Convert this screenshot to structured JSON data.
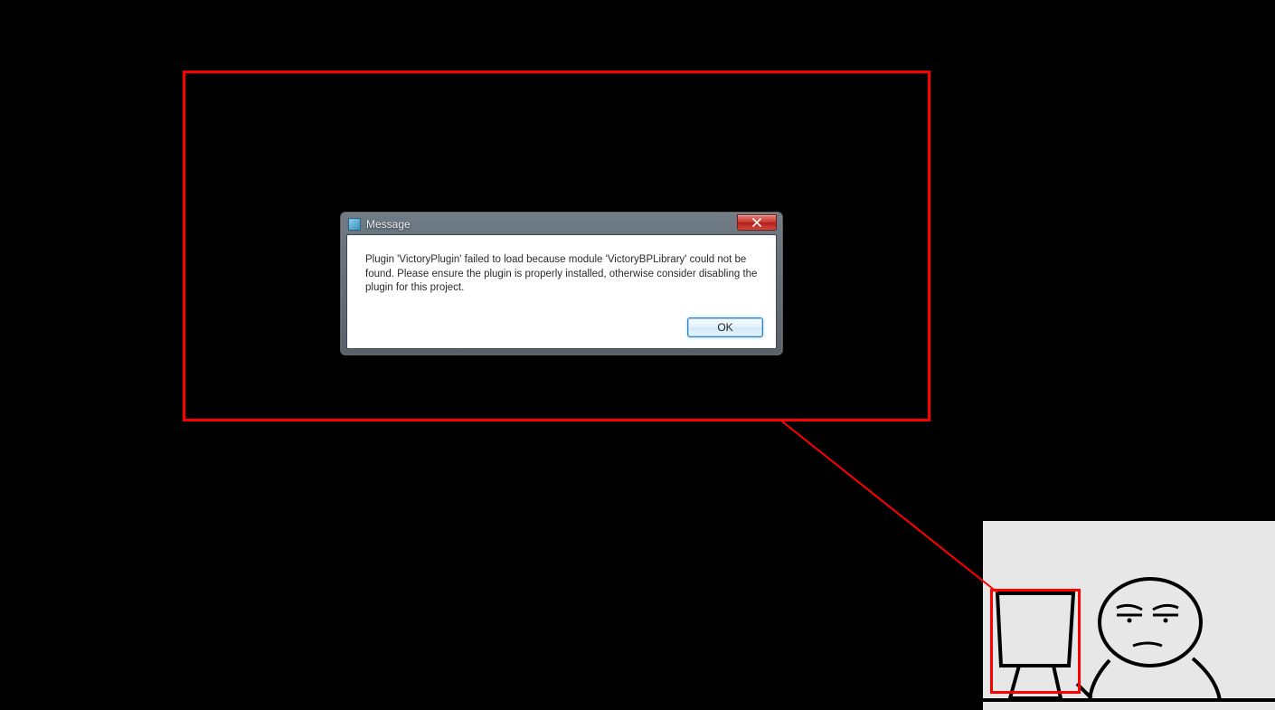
{
  "dialog": {
    "title": "Message",
    "body": "Plugin 'VictoryPlugin' failed to load because module 'VictoryBPLibrary' could not be found.  Please ensure the plugin is properly installed, otherwise consider disabling the plugin for this project.",
    "ok_label": "OK"
  },
  "annotation": {
    "highlight_color": "#ff0000"
  }
}
